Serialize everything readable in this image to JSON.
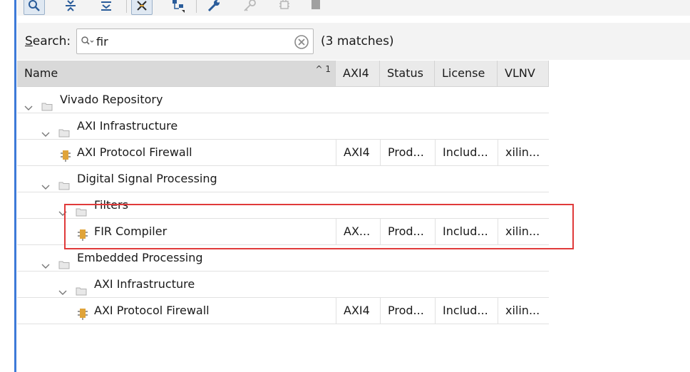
{
  "toolbar": {
    "icons": [
      "search-icon",
      "collapse-all-icon",
      "expand-all-icon",
      "filter-icon",
      "hierarchy-icon",
      "wrench-icon",
      "key-icon",
      "chip-icon",
      "stop-icon"
    ]
  },
  "search": {
    "label_mnemonic": "S",
    "label_rest": "earch:",
    "value": "fir",
    "match_count": "(3 matches)"
  },
  "table": {
    "columns": [
      {
        "label": "Name",
        "sort_indicator": "^ 1"
      },
      {
        "label": "AXI4"
      },
      {
        "label": "Status"
      },
      {
        "label": "License"
      },
      {
        "label": "VLNV"
      }
    ],
    "rows": [
      {
        "name": "Vivado Repository",
        "type": "folder",
        "depth": 0,
        "expanded": true
      },
      {
        "name": "AXI Infrastructure",
        "type": "folder",
        "depth": 1,
        "expanded": true
      },
      {
        "name": "AXI Protocol Firewall",
        "type": "ip",
        "depth": 2,
        "axi4": "AXI4",
        "status": "Prod...",
        "license": "Includ...",
        "vlnv": "xilin..."
      },
      {
        "name": "Digital Signal Processing",
        "type": "folder",
        "depth": 1,
        "expanded": true
      },
      {
        "name": "Filters",
        "type": "folder",
        "depth": 2,
        "expanded": true
      },
      {
        "name": "FIR Compiler",
        "type": "ip",
        "depth": 3,
        "axi4": "AX...",
        "status": "Prod...",
        "license": "Includ...",
        "vlnv": "xilin..."
      },
      {
        "name": "Embedded Processing",
        "type": "folder",
        "depth": 1,
        "expanded": true
      },
      {
        "name": "AXI Infrastructure",
        "type": "folder",
        "depth": 2,
        "expanded": true
      },
      {
        "name": "AXI Protocol Firewall",
        "type": "ip",
        "depth": 3,
        "axi4": "AXI4",
        "status": "Prod...",
        "license": "Includ...",
        "vlnv": "xilin..."
      }
    ]
  },
  "colors": {
    "accent": "#3d7ad8",
    "highlight": "#e03a3a",
    "ip_icon": "#e0a43a"
  }
}
